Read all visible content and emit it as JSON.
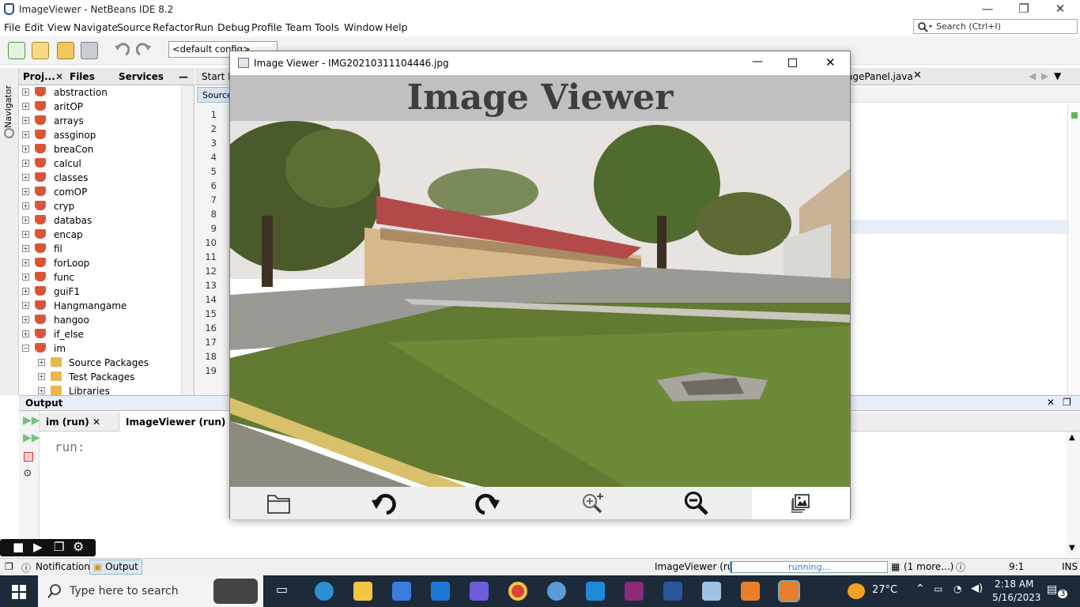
{
  "window": {
    "title": "ImageViewer - NetBeans IDE 8.2",
    "minimize": "—",
    "maximize": "❐",
    "close": "✕"
  },
  "menubar": {
    "items": [
      "File",
      "Edit",
      "View",
      "Navigate",
      "Source",
      "Refactor",
      "Run",
      "Debug",
      "Profile",
      "Team",
      "Tools",
      "Window",
      "Help"
    ],
    "search_placeholder": "Search (Ctrl+I)"
  },
  "toolbar": {
    "config_value": "<default config>"
  },
  "left_strip": {
    "navigator_label": "Navigator"
  },
  "projects_panel": {
    "tabs": [
      "Proj...",
      "Files",
      "Services"
    ],
    "items": [
      "abstraction",
      "aritOP",
      "arrays",
      "assginop",
      "breaCon",
      "calcul",
      "classes",
      "comOP",
      "cryp",
      "databas",
      "encap",
      "fil",
      "forLoop",
      "func",
      "guiF1",
      "Hangmangame",
      "hangoo",
      "if_else",
      "im"
    ],
    "sub_items": [
      "Source Packages",
      "Test Packages",
      "Libraries"
    ]
  },
  "editor": {
    "tabs": [
      "Start P",
      "agePanel.java"
    ],
    "sub_tab": "Source",
    "line_numbers": [
      "1",
      "2",
      "3",
      "4",
      "5",
      "6",
      "7",
      "8",
      "9",
      "10",
      "11",
      "12",
      "13",
      "14",
      "15",
      "16",
      "17",
      "18",
      "19"
    ]
  },
  "output": {
    "title": "Output",
    "tabs": [
      "im (run)",
      "ImageViewer (run)"
    ],
    "text": "run:"
  },
  "statusbar": {
    "notifications": "Notifications",
    "output": "Output",
    "run_label": "ImageViewer (run)",
    "progress_text": "running...",
    "more": "(1 more...)",
    "position": "9:1",
    "mode": "INS"
  },
  "taskbar": {
    "search_placeholder": "Type here to search",
    "weather": "27°C",
    "time": "2:18 AM",
    "date": "5/16/2023",
    "notif_count": "3"
  },
  "image_viewer": {
    "title": "Image Viewer - IMG20210311104446.jpg",
    "header": "Image Viewer",
    "tools": [
      "open-folder-icon",
      "rotate-left-icon",
      "rotate-right-icon",
      "zoom-in-icon",
      "zoom-out-icon",
      "gallery-icon"
    ]
  },
  "colors": {
    "netbeans_blue": "#264c82",
    "header_gray": "#c0c0c0",
    "header_text": "#3e3e3e",
    "taskbar": "#1c2a3a"
  }
}
